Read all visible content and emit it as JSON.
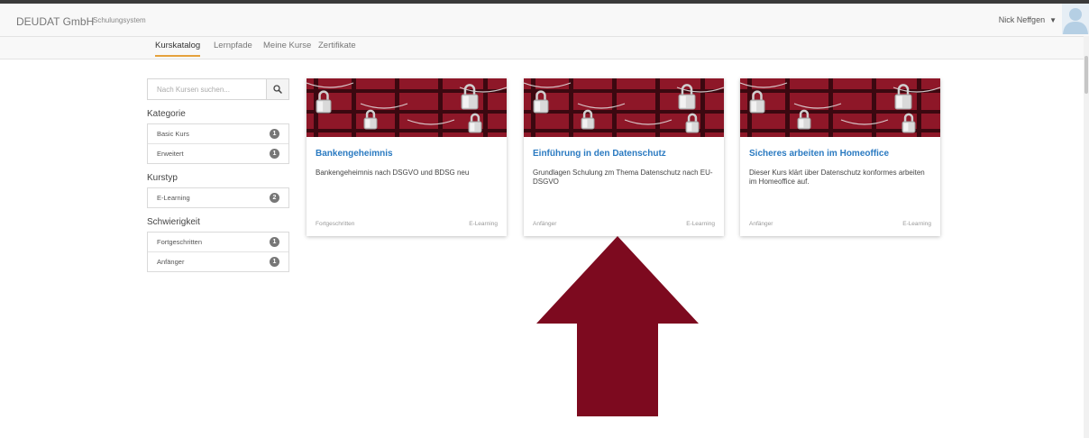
{
  "header": {
    "brand": "DEUDAT GmbH",
    "subtitle": "Schulungsystem",
    "user_name": "Nick Neffgen"
  },
  "nav": {
    "tabs": [
      {
        "label": "Kurskatalog",
        "active": true
      },
      {
        "label": "Lernpfade",
        "active": false
      },
      {
        "label": "Meine Kurse",
        "active": false
      },
      {
        "label": "Zertifikate",
        "active": false
      }
    ]
  },
  "sidebar": {
    "search_placeholder": "Nach Kursen suchen...",
    "sections": [
      {
        "title": "Kategorie",
        "items": [
          {
            "label": "Basic Kurs",
            "count": "1"
          },
          {
            "label": "Erweitert",
            "count": "1"
          }
        ]
      },
      {
        "title": "Kurstyp",
        "items": [
          {
            "label": "E-Learning",
            "count": "2"
          }
        ]
      },
      {
        "title": "Schwierigkeit",
        "items": [
          {
            "label": "Fortgeschritten",
            "count": "1"
          },
          {
            "label": "Anfänger",
            "count": "1"
          }
        ]
      }
    ]
  },
  "courses": [
    {
      "title": "Bankengeheimnis",
      "description": "Bankengeheimnis nach DSGVO und BDSG neu",
      "level": "Fortgeschritten",
      "type": "E-Learning"
    },
    {
      "title": "Einführung in den Datenschutz",
      "description": "Grundlagen Schulung zm Thema Datenschutz nach EU-DSGVO",
      "level": "Anfänger",
      "type": "E-Learning"
    },
    {
      "title": "Sicheres arbeiten im Homeoffice",
      "description": "Dieser Kurs klärt über Datenschutz konformes arbeiten im Homeoffice auf.",
      "level": "Anfänger",
      "type": "E-Learning"
    }
  ],
  "colors": {
    "accent": "#e5a23d",
    "link": "#2a7ac1",
    "arrow": "#7d0a1f",
    "card_image": "#8e1728"
  }
}
